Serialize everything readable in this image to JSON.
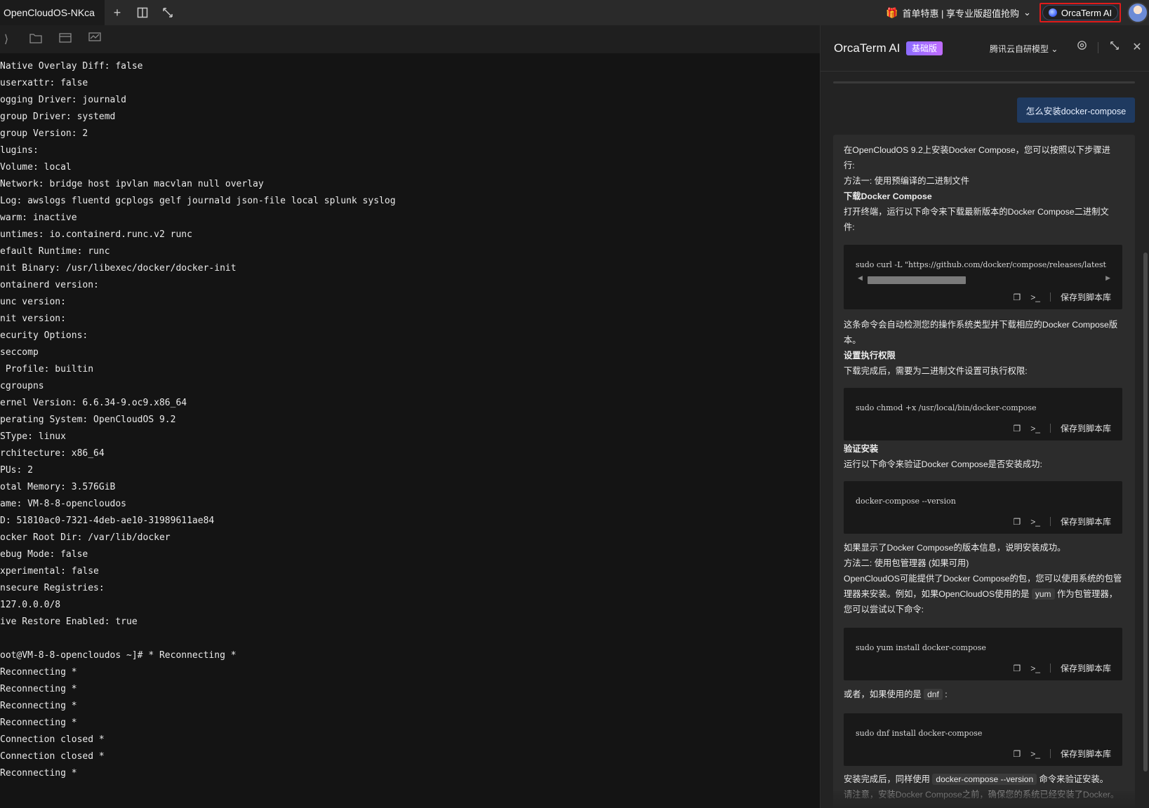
{
  "topbar": {
    "tab_title": "OpenCloudOS-NKca",
    "icons": [
      "plus-icon",
      "split-view-icon",
      "expand-icon"
    ],
    "promo_text": "首单特惠 | 享专业版超值抢购",
    "ai_button_label": "OrcaTerm AI"
  },
  "terminal": {
    "toolbar_icons": [
      "new-session-icon",
      "sftp-folder-icon",
      "file-transfer-icon",
      "monitor-icon"
    ],
    "lines": [
      "Native Overlay Diff: false",
      "userxattr: false",
      "ogging Driver: journald",
      "group Driver: systemd",
      "group Version: 2",
      "lugins:",
      "Volume: local",
      "Network: bridge host ipvlan macvlan null overlay",
      "Log: awslogs fluentd gcplogs gelf journald json-file local splunk syslog",
      "warm: inactive",
      "untimes: io.containerd.runc.v2 runc",
      "efault Runtime: runc",
      "nit Binary: /usr/libexec/docker/docker-init",
      "ontainerd version:",
      "unc version:",
      "nit version:",
      "ecurity Options:",
      "seccomp",
      " Profile: builtin",
      "cgroupns",
      "ernel Version: 6.6.34-9.oc9.x86_64",
      "perating System: OpenCloudOS 9.2",
      "SType: linux",
      "rchitecture: x86_64",
      "PUs: 2",
      "otal Memory: 3.576GiB",
      "ame: VM-8-8-opencloudos",
      "D: 51810ac0-7321-4deb-ae10-31989611ae84",
      "ocker Root Dir: /var/lib/docker",
      "ebug Mode: false",
      "xperimental: false",
      "nsecure Registries:",
      "127.0.0.0/8",
      "ive Restore Enabled: true",
      "",
      "oot@VM-8-8-opencloudos ~]# * Reconnecting *",
      "Reconnecting *",
      "Reconnecting *",
      "Reconnecting *",
      "Reconnecting *",
      "Connection closed *",
      "Connection closed *",
      "Reconnecting *"
    ]
  },
  "panel": {
    "title": "OrcaTerm AI",
    "badge": "基础版",
    "model": "腾讯云自研模型",
    "user_message": "怎么安装docker-compose",
    "answer": {
      "intro_1": "在OpenCloudOS 9.2上安装Docker Compose，您可以按照以下步骤进",
      "intro_2": "行:",
      "method1": "方法一: 使用预编译的二进制文件",
      "h_download": "下载Docker Compose",
      "download_1": "打开终端，运行以下命令来下载最新版本的Docker Compose二进制文",
      "download_2": "件:",
      "cmd_download": "sudo curl -L \"https://github.com/docker/compose/releases/latest",
      "auto_detect_1": "这条命令会自动检测您的操作系统类型并下载相应的Docker Compose版",
      "auto_detect_2": "本。",
      "h_perm": "设置执行权限",
      "perm_text": "下载完成后，需要为二进制文件设置可执行权限:",
      "cmd_chmod": "sudo chmod +x /usr/local/bin/docker-compose",
      "h_verify": "验证安装",
      "verify_text": "运行以下命令来验证Docker Compose是否安装成功:",
      "cmd_version": "docker-compose --version",
      "success_text": "如果显示了Docker Compose的版本信息，说明安装成功。",
      "method2": "方法二: 使用包管理器 (如果可用)",
      "pm_1": "OpenCloudOS可能提供了Docker Compose的包，您可以使用系统的包管",
      "pm_2a": "理器来安装。例如，如果OpenCloudOS使用的是",
      "pm_yum": "yum",
      "pm_2b": "作为包管理器，",
      "pm_3": "您可以尝试以下命令:",
      "cmd_yum": "sudo yum install docker-compose",
      "or_a": "或者，如果使用的是",
      "or_dnf": "dnf",
      "or_b": ":",
      "cmd_dnf": "sudo dnf install docker-compose",
      "after_a": "安装完成后，同样使用",
      "after_code": "docker-compose --version",
      "after_b": "命令来验证安装。",
      "note": "请注意，安装Docker Compose之前，确保您的系统已经安装了Docker。"
    },
    "save_label": "保存到脚本库"
  }
}
